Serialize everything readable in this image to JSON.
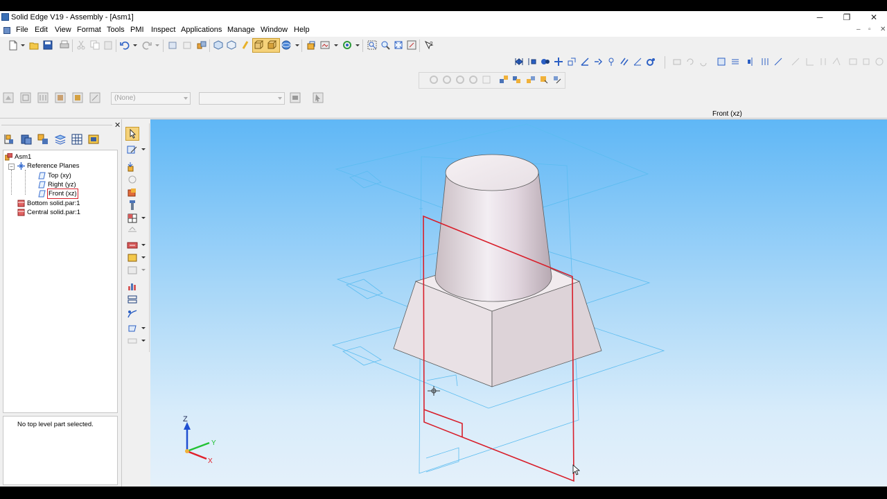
{
  "window": {
    "title": "Solid Edge V19 - Assembly - [Asm1]",
    "controls": {
      "minimize": "─",
      "restore": "❐",
      "close": "✕"
    }
  },
  "menubar": {
    "items": [
      "File",
      "Edit",
      "View",
      "Format",
      "Tools",
      "PMI",
      "Inspect",
      "Applications",
      "Manage",
      "Window",
      "Help"
    ],
    "mdi": {
      "minimize": "–",
      "restore": "▫",
      "close": "✕"
    }
  },
  "combos": {
    "layer": "(None)",
    "second": ""
  },
  "view": {
    "active_plane": "Front (xz)"
  },
  "pathfinder": {
    "root": "Asm1",
    "reference_planes": "Reference Planes",
    "planes": [
      "Top (xy)",
      "Right (yz)",
      "Front (xz)"
    ],
    "selected_plane": "Front (xz)",
    "parts": [
      "Bottom solid.par:1",
      "Central solid.par:1"
    ],
    "status": "No top level part selected."
  },
  "triad": {
    "z": "Z",
    "y": "Y",
    "x": "X"
  },
  "colors": {
    "viewport_top": "#5fb7f6",
    "viewport_bottom": "#e4f0fa",
    "reference_plane": "#5bbcf0",
    "selected_plane": "#d81e2a",
    "axis_z": "#1f4fd1",
    "axis_y": "#22c234",
    "axis_x": "#e0202a"
  }
}
